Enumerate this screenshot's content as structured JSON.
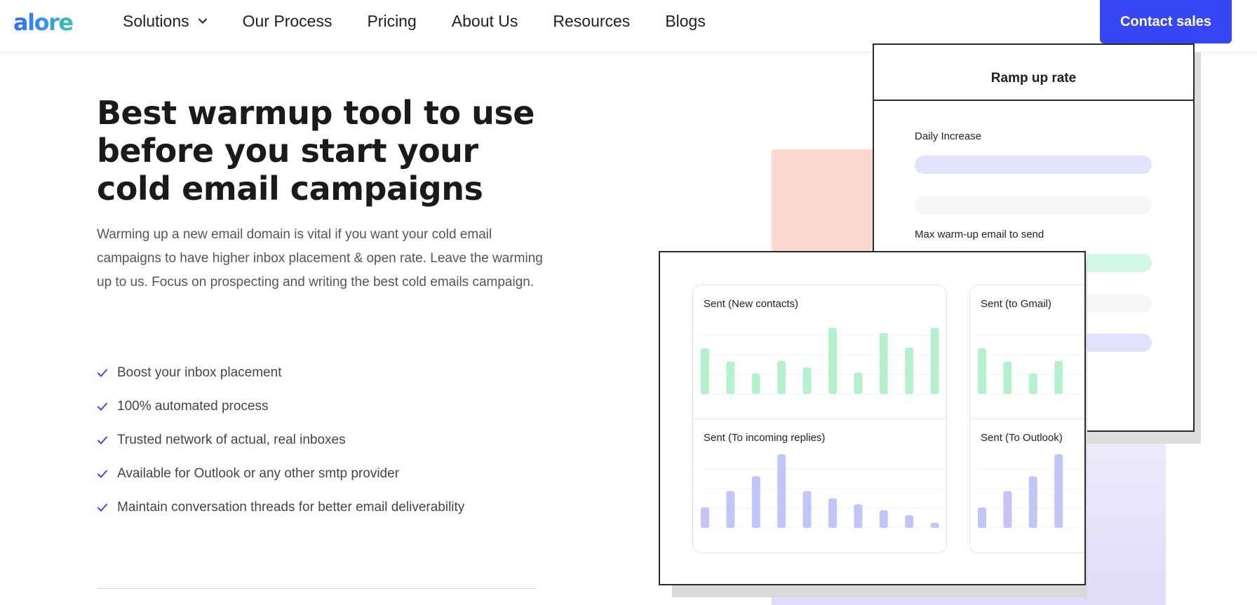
{
  "header": {
    "logo": "alore",
    "nav": [
      {
        "label": "Solutions",
        "has_dropdown": true
      },
      {
        "label": "Our Process"
      },
      {
        "label": "Pricing"
      },
      {
        "label": "About Us"
      },
      {
        "label": "Resources"
      },
      {
        "label": "Blogs"
      }
    ],
    "cta_label": "Contact sales",
    "cta_color": "#3646f5"
  },
  "hero": {
    "title": "Best warmup tool to use before you start your cold email campaigns",
    "description": "Warming up a new email domain is vital if you want your cold email campaigns to have higher inbox placement & open rate. Leave the warming up to us. Focus on prospecting and writing the best cold emails campaign.",
    "features": [
      "Boost your inbox placement",
      "100% automated process",
      "Trusted network of actual, real inboxes",
      "Available for Outlook or any other smtp provider",
      "Maintain conversation threads for better email deliverability"
    ],
    "check_icon": "check-icon",
    "check_color": "#3646f5"
  },
  "illustration": {
    "ramp_panel": {
      "title": "Ramp up rate",
      "daily_label": "Daily Increase",
      "max_label": "Max warm-up  email to send"
    },
    "colors": {
      "green_bar": "#b5f0cf",
      "purple_bar": "#c2c5f8",
      "pill_blue": "#e0e3fb",
      "pill_green": "#d2f7e4",
      "pill_gray": "#f6f6f6"
    },
    "charts": [
      {
        "title": "Sent (New contacts)",
        "color": "green",
        "values": [
          62,
          44,
          28,
          45,
          36,
          90,
          29,
          83,
          63,
          90
        ]
      },
      {
        "title": "Sent (to Gmail)",
        "color": "green",
        "values": [
          62,
          44,
          28,
          45
        ]
      },
      {
        "title": "Sent (To incoming replies)",
        "color": "purple",
        "values": [
          28,
          50,
          70,
          100,
          50,
          40,
          32,
          24,
          17,
          7
        ]
      },
      {
        "title": "Sent (To Outlook)",
        "color": "purple",
        "values": [
          28,
          50,
          70,
          100
        ]
      }
    ]
  }
}
